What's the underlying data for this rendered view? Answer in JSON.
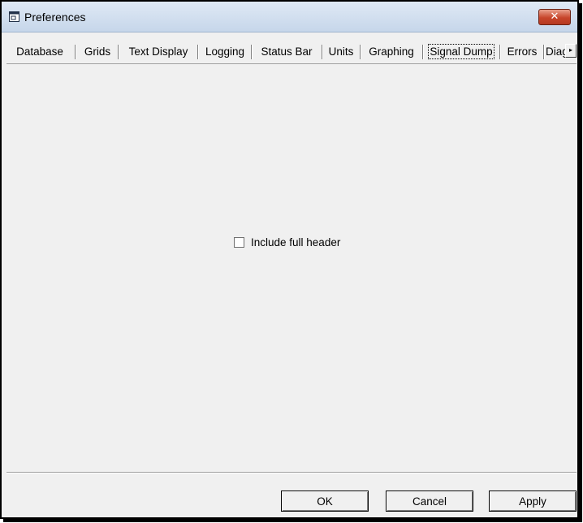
{
  "window": {
    "title": "Preferences",
    "close_symbol": "✕"
  },
  "tabs": [
    {
      "label": "Database",
      "active": false
    },
    {
      "label": "Grids",
      "active": false
    },
    {
      "label": "Text Display",
      "active": false
    },
    {
      "label": "Logging",
      "active": false
    },
    {
      "label": "Status Bar",
      "active": false
    },
    {
      "label": "Units",
      "active": false
    },
    {
      "label": "Graphing",
      "active": false
    },
    {
      "label": "Signal Dump",
      "active": true
    },
    {
      "label": "Errors",
      "active": false
    },
    {
      "label": "Diag",
      "active": false
    }
  ],
  "tab_scroll_symbol": "▸",
  "panel": {
    "include_full_header": {
      "label": "Include full header",
      "checked": false
    }
  },
  "buttons": {
    "ok": "OK",
    "cancel": "Cancel",
    "apply": "Apply"
  },
  "icons": {
    "window": "window-icon",
    "close": "close-icon",
    "scroll": "tab-scroll-right-icon"
  }
}
